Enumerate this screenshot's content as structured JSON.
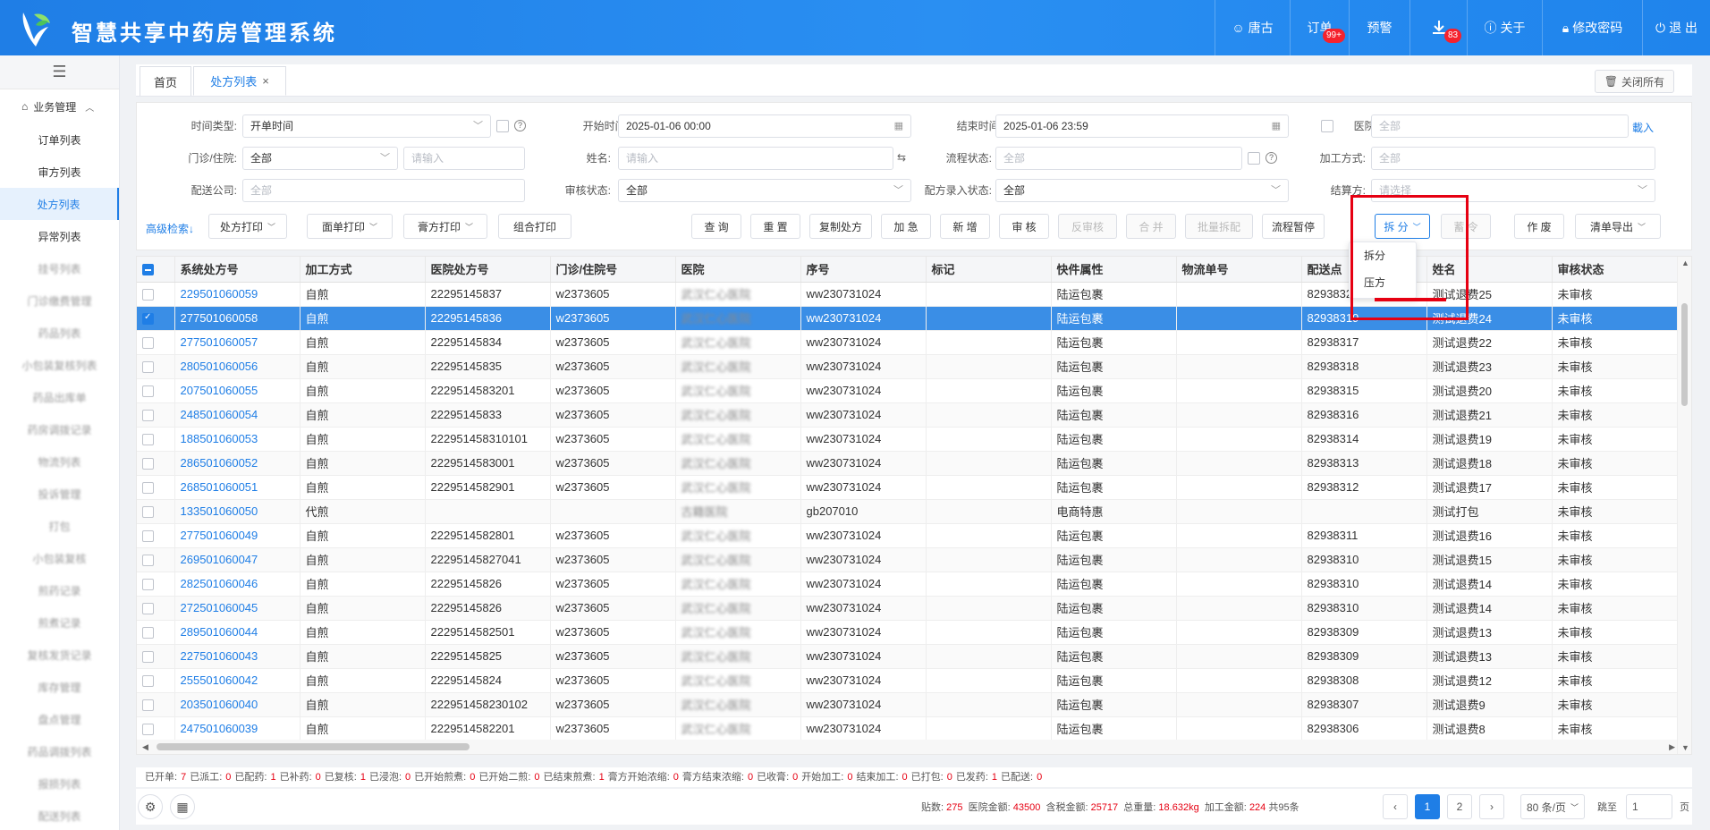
{
  "app": {
    "title": "智慧共享中药房管理系统"
  },
  "topnav": {
    "user": "唐古",
    "orders": "订单",
    "orders_badge": "99+",
    "warning": "预警",
    "download_badge": "83",
    "about": "关于",
    "change_password": "修改密码",
    "logout": "退 出"
  },
  "sidebar": {
    "group": "业务管理",
    "items": [
      {
        "label": "订单列表"
      },
      {
        "label": "审方列表"
      },
      {
        "label": "处方列表"
      },
      {
        "label": "异常列表"
      },
      {
        "label": "挂号列表"
      },
      {
        "label": "门诊缴费管理"
      },
      {
        "label": "药品列表"
      },
      {
        "label": "小包装复核列表"
      },
      {
        "label": "药品出库单"
      },
      {
        "label": "药房调拨记录"
      },
      {
        "label": "物流列表"
      },
      {
        "label": "投诉管理"
      },
      {
        "label": "打包"
      },
      {
        "label": "小包装复核"
      },
      {
        "label": "煎药记录"
      },
      {
        "label": "煎煮记录"
      },
      {
        "label": "复核发货记录"
      },
      {
        "label": "库存管理"
      },
      {
        "label": "盘点管理"
      },
      {
        "label": "药品调拨列表"
      },
      {
        "label": "报损列表"
      },
      {
        "label": "配送列表"
      }
    ]
  },
  "tabs": {
    "home": "首页",
    "current": "处方列表",
    "close_all": "关闭所有"
  },
  "filters": {
    "time_type_label": "时间类型:",
    "time_type_value": "开单时间",
    "start_time_label": "开始时间:",
    "start_time_value": "2025-01-06 00:00",
    "end_time_label": "结束时间:",
    "end_time_value": "2025-01-06 23:59",
    "hospital_label": "医院:",
    "hospital_placeholder": "全部",
    "load_link": "載入",
    "clinic_label": "门诊/住院:",
    "clinic_value": "全部",
    "clinic_input_placeholder": "请输入",
    "name_label": "姓名:",
    "name_placeholder": "请输入",
    "flow_status_label": "流程状态:",
    "flow_status_placeholder": "全部",
    "process_method_label": "加工方式:",
    "process_method_placeholder": "全部",
    "delivery_company_label": "配送公司:",
    "delivery_company_placeholder": "全部",
    "review_status_label": "审核状态:",
    "review_status_value": "全部",
    "delivery_entry_label": "配方录入状态:",
    "delivery_entry_value": "全部",
    "settle_label": "结算方:",
    "settle_placeholder": "请选择",
    "advanced_search": "高级检索"
  },
  "toolbar": {
    "rx_print": "处方打印",
    "face_print": "面单打印",
    "cream_print": "膏方打印",
    "combo_print": "组合打印",
    "query": "查 询",
    "reset": "重 置",
    "copy_rx": "复制处方",
    "urgent": "加 急",
    "add": "新 增",
    "review": "审 核",
    "unreview": "反审核",
    "merge": "合 并",
    "batch_dispense": "批量拆配",
    "flow_pause": "流程暂停",
    "split": "拆 分",
    "chase": "蓄 令",
    "void": "作 废",
    "export": "清单导出"
  },
  "split_menu": {
    "options": [
      "拆分",
      "压方"
    ]
  },
  "table": {
    "headers": [
      "系统处方号",
      "加工方式",
      "医院处方号",
      "门诊/住院号",
      "医院",
      "序号",
      "标记",
      "快件属性",
      "物流单号",
      "配送点",
      "姓名",
      "审核状态"
    ],
    "rows": [
      {
        "code": "229501060059",
        "method": "自煎",
        "hosp_no": "22295145837",
        "clinic_no": "w2373605",
        "hospital": "武汉仁心医院",
        "seq": "ww230731024",
        "mark": "",
        "express": "陆运包裹",
        "logistics": "",
        "point": "82938320",
        "name": "测试退费25",
        "status": "未审核",
        "selected": false
      },
      {
        "code": "277501060058",
        "method": "自煎",
        "hosp_no": "22295145836",
        "clinic_no": "w2373605",
        "hospital": "武汉仁心医院",
        "seq": "ww230731024",
        "mark": "",
        "express": "陆运包裹",
        "logistics": "",
        "point": "82938319",
        "name": "测试退费24",
        "status": "未审核",
        "selected": true
      },
      {
        "code": "277501060057",
        "method": "自煎",
        "hosp_no": "22295145834",
        "clinic_no": "w2373605",
        "hospital": "武汉仁心医院",
        "seq": "ww230731024",
        "mark": "",
        "express": "陆运包裹",
        "logistics": "",
        "point": "82938317",
        "name": "测试退费22",
        "status": "未审核",
        "selected": false
      },
      {
        "code": "280501060056",
        "method": "自煎",
        "hosp_no": "22295145835",
        "clinic_no": "w2373605",
        "hospital": "武汉仁心医院",
        "seq": "ww230731024",
        "mark": "",
        "express": "陆运包裹",
        "logistics": "",
        "point": "82938318",
        "name": "测试退费23",
        "status": "未审核",
        "selected": false
      },
      {
        "code": "207501060055",
        "method": "自煎",
        "hosp_no": "2229514583201",
        "clinic_no": "w2373605",
        "hospital": "武汉仁心医院",
        "seq": "ww230731024",
        "mark": "",
        "express": "陆运包裹",
        "logistics": "",
        "point": "82938315",
        "name": "测试退费20",
        "status": "未审核",
        "selected": false
      },
      {
        "code": "248501060054",
        "method": "自煎",
        "hosp_no": "22295145833",
        "clinic_no": "w2373605",
        "hospital": "武汉仁心医院",
        "seq": "ww230731024",
        "mark": "",
        "express": "陆运包裹",
        "logistics": "",
        "point": "82938316",
        "name": "测试退费21",
        "status": "未审核",
        "selected": false
      },
      {
        "code": "188501060053",
        "method": "自煎",
        "hosp_no": "222951458310101",
        "clinic_no": "w2373605",
        "hospital": "武汉仁心医院",
        "seq": "ww230731024",
        "mark": "",
        "express": "陆运包裹",
        "logistics": "",
        "point": "82938314",
        "name": "测试退费19",
        "status": "未审核",
        "selected": false
      },
      {
        "code": "286501060052",
        "method": "自煎",
        "hosp_no": "2229514583001",
        "clinic_no": "w2373605",
        "hospital": "武汉仁心医院",
        "seq": "ww230731024",
        "mark": "",
        "express": "陆运包裹",
        "logistics": "",
        "point": "82938313",
        "name": "测试退费18",
        "status": "未审核",
        "selected": false
      },
      {
        "code": "268501060051",
        "method": "自煎",
        "hosp_no": "2229514582901",
        "clinic_no": "w2373605",
        "hospital": "武汉仁心医院",
        "seq": "ww230731024",
        "mark": "",
        "express": "陆运包裹",
        "logistics": "",
        "point": "82938312",
        "name": "测试退费17",
        "status": "未审核",
        "selected": false
      },
      {
        "code": "133501060050",
        "method": "代煎",
        "hosp_no": "",
        "clinic_no": "",
        "hospital": "古籍医院",
        "seq": "gb207010",
        "mark": "",
        "express": "电商特惠",
        "logistics": "",
        "point": "",
        "name": "测试打包",
        "status": "未审核",
        "selected": false
      },
      {
        "code": "277501060049",
        "method": "自煎",
        "hosp_no": "2229514582801",
        "clinic_no": "w2373605",
        "hospital": "武汉仁心医院",
        "seq": "ww230731024",
        "mark": "",
        "express": "陆运包裹",
        "logistics": "",
        "point": "82938311",
        "name": "测试退费16",
        "status": "未审核",
        "selected": false
      },
      {
        "code": "269501060047",
        "method": "自煎",
        "hosp_no": "22295145827041",
        "clinic_no": "w2373605",
        "hospital": "武汉仁心医院",
        "seq": "ww230731024",
        "mark": "",
        "express": "陆运包裹",
        "logistics": "",
        "point": "82938310",
        "name": "测试退费15",
        "status": "未审核",
        "selected": false
      },
      {
        "code": "282501060046",
        "method": "自煎",
        "hosp_no": "22295145826",
        "clinic_no": "w2373605",
        "hospital": "武汉仁心医院",
        "seq": "ww230731024",
        "mark": "",
        "express": "陆运包裹",
        "logistics": "",
        "point": "82938310",
        "name": "测试退费14",
        "status": "未审核",
        "selected": false
      },
      {
        "code": "272501060045",
        "method": "自煎",
        "hosp_no": "22295145826",
        "clinic_no": "w2373605",
        "hospital": "武汉仁心医院",
        "seq": "ww230731024",
        "mark": "",
        "express": "陆运包裹",
        "logistics": "",
        "point": "82938310",
        "name": "测试退费14",
        "status": "未审核",
        "selected": false
      },
      {
        "code": "289501060044",
        "method": "自煎",
        "hosp_no": "2229514582501",
        "clinic_no": "w2373605",
        "hospital": "武汉仁心医院",
        "seq": "ww230731024",
        "mark": "",
        "express": "陆运包裹",
        "logistics": "",
        "point": "82938309",
        "name": "测试退费13",
        "status": "未审核",
        "selected": false
      },
      {
        "code": "227501060043",
        "method": "自煎",
        "hosp_no": "22295145825",
        "clinic_no": "w2373605",
        "hospital": "武汉仁心医院",
        "seq": "ww230731024",
        "mark": "",
        "express": "陆运包裹",
        "logistics": "",
        "point": "82938309",
        "name": "测试退费13",
        "status": "未审核",
        "selected": false
      },
      {
        "code": "255501060042",
        "method": "自煎",
        "hosp_no": "22295145824",
        "clinic_no": "w2373605",
        "hospital": "武汉仁心医院",
        "seq": "ww230731024",
        "mark": "",
        "express": "陆运包裹",
        "logistics": "",
        "point": "82938308",
        "name": "测试退费12",
        "status": "未审核",
        "selected": false
      },
      {
        "code": "203501060040",
        "method": "自煎",
        "hosp_no": "222951458230102",
        "clinic_no": "w2373605",
        "hospital": "武汉仁心医院",
        "seq": "ww230731024",
        "mark": "",
        "express": "陆运包裹",
        "logistics": "",
        "point": "82938307",
        "name": "测试退费9",
        "status": "未审核",
        "selected": false
      },
      {
        "code": "247501060039",
        "method": "自煎",
        "hosp_no": "2229514582201",
        "clinic_no": "w2373605",
        "hospital": "武汉仁心医院",
        "seq": "ww230731024",
        "mark": "",
        "express": "陆运包裹",
        "logistics": "",
        "point": "82938306",
        "name": "测试退费8",
        "status": "未审核",
        "selected": false
      }
    ]
  },
  "status_counts": [
    {
      "label": "已开单",
      "value": "7"
    },
    {
      "label": "已派工",
      "value": "0"
    },
    {
      "label": "已配药",
      "value": "1"
    },
    {
      "label": "已补药",
      "value": "0"
    },
    {
      "label": "已复核",
      "value": "1"
    },
    {
      "label": "已浸泡",
      "value": "0"
    },
    {
      "label": "已开始煎煮",
      "value": "0"
    },
    {
      "label": "已开始二煎",
      "value": "0"
    },
    {
      "label": "已结束煎煮",
      "value": "1"
    },
    {
      "label": "膏方开始浓缩",
      "value": "0"
    },
    {
      "label": "膏方结束浓缩",
      "value": "0"
    },
    {
      "label": "已收膏",
      "value": "0"
    },
    {
      "label": "开始加工",
      "value": "0"
    },
    {
      "label": "结束加工",
      "value": "0"
    },
    {
      "label": "已打包",
      "value": "0"
    },
    {
      "label": "已发药",
      "value": "1"
    },
    {
      "label": "已配送",
      "value": "0"
    }
  ],
  "footer": {
    "doses_label": "贴数:",
    "doses": "275",
    "hosp_amount_label": "医院金额:",
    "hosp_amount": "43500",
    "tax_amount_label": "含税金额:",
    "tax_amount": "25717",
    "weight_label": "总重量:",
    "weight": "18.632kg",
    "process_amount_label": "加工金额:",
    "process_amount": "224",
    "total": "共95条",
    "pages": [
      "1",
      "2"
    ],
    "page_size": "80 条/页",
    "goto_label": "跳至",
    "goto_value": "1",
    "page_suffix": "页"
  }
}
